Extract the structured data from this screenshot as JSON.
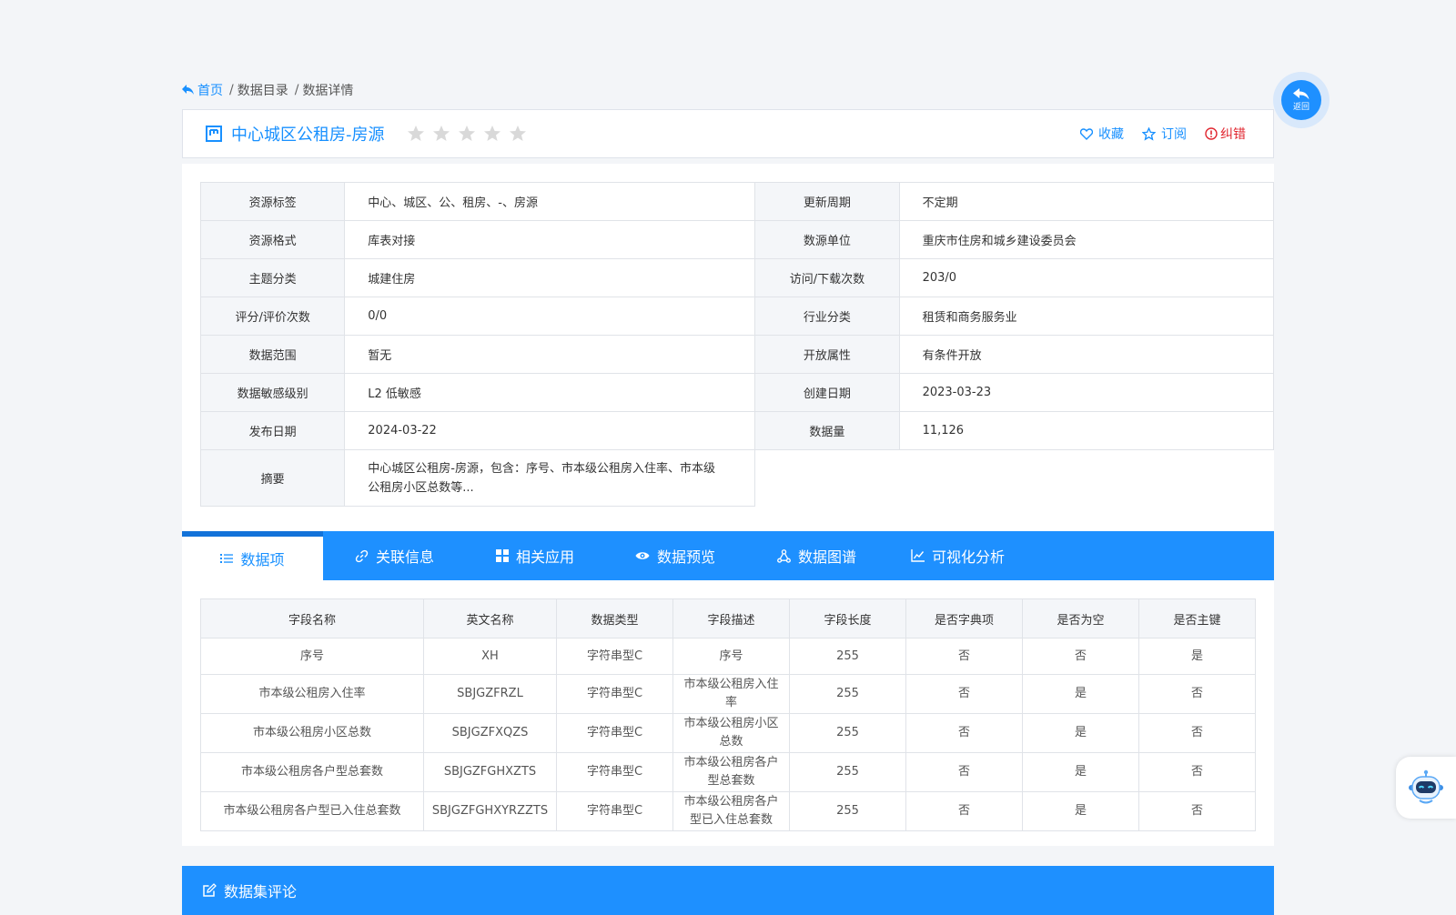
{
  "breadcrumb": {
    "home": "首页",
    "items": [
      "数据目录",
      "数据详情"
    ],
    "separator": "/"
  },
  "header": {
    "title": "中心城区公租房-房源",
    "rating_stars": 0,
    "rating_max": 5,
    "actions": {
      "favorite": "收藏",
      "subscribe": "订阅",
      "report": "纠错"
    }
  },
  "info": {
    "rows": [
      {
        "k1": "资源标签",
        "v1": "中心、城区、公、租房、-、房源",
        "k2": "更新周期",
        "v2": "不定期"
      },
      {
        "k1": "资源格式",
        "v1": "库表对接",
        "k2": "数源单位",
        "v2": "重庆市住房和城乡建设委员会"
      },
      {
        "k1": "主题分类",
        "v1": "城建住房",
        "k2": "访问/下载次数",
        "v2": "203/0"
      },
      {
        "k1": "评分/评价次数",
        "v1": "0/0",
        "k2": "行业分类",
        "v2": "租赁和商务服务业"
      },
      {
        "k1": "数据范围",
        "v1": "暂无",
        "k2": "开放属性",
        "v2": "有条件开放"
      },
      {
        "k1": "数据敏感级别",
        "v1": "L2 低敏感",
        "k2": "创建日期",
        "v2": "2023-03-23"
      },
      {
        "k1": "发布日期",
        "v1": "2024-03-22",
        "k2": "数据量",
        "v2": "11,126"
      }
    ],
    "summary_label": "摘要",
    "summary": "中心城区公租房-房源，包含：序号、市本级公租房入住率、市本级公租房小区总数等..."
  },
  "tabs": [
    {
      "label": "数据项",
      "icon": "list-icon",
      "active": true
    },
    {
      "label": "关联信息",
      "icon": "link-icon",
      "active": false
    },
    {
      "label": "相关应用",
      "icon": "apps-icon",
      "active": false
    },
    {
      "label": "数据预览",
      "icon": "eye-icon",
      "active": false
    },
    {
      "label": "数据图谱",
      "icon": "graph-icon",
      "active": false
    },
    {
      "label": "可视化分析",
      "icon": "line-chart-icon",
      "active": false
    }
  ],
  "fields": {
    "headers": [
      "字段名称",
      "英文名称",
      "数据类型",
      "字段描述",
      "字段长度",
      "是否字典项",
      "是否为空",
      "是否主键"
    ],
    "rows": [
      [
        "序号",
        "XH",
        "字符串型C",
        "序号",
        "255",
        "否",
        "否",
        "是"
      ],
      [
        "市本级公租房入住率",
        "SBJGZFRZL",
        "字符串型C",
        "市本级公租房入住率",
        "255",
        "否",
        "是",
        "否"
      ],
      [
        "市本级公租房小区总数",
        "SBJGZFXQZS",
        "字符串型C",
        "市本级公租房小区总数",
        "255",
        "否",
        "是",
        "否"
      ],
      [
        "市本级公租房各户型总套数",
        "SBJGZFGHXZTS",
        "字符串型C",
        "市本级公租房各户型总套数",
        "255",
        "否",
        "是",
        "否"
      ],
      [
        "市本级公租房各户型已入住总套数",
        "SBJGZFGHXYRZZTS",
        "字符串型C",
        "市本级公租房各户型已入住总套数",
        "255",
        "否",
        "是",
        "否"
      ]
    ]
  },
  "comments": {
    "title": "数据集评论"
  },
  "float": {
    "back_label": "返回"
  },
  "colors": {
    "primary": "#1e90ff",
    "link": "#1890ff",
    "danger": "#e0262f",
    "star_empty": "#d9d9d9"
  }
}
